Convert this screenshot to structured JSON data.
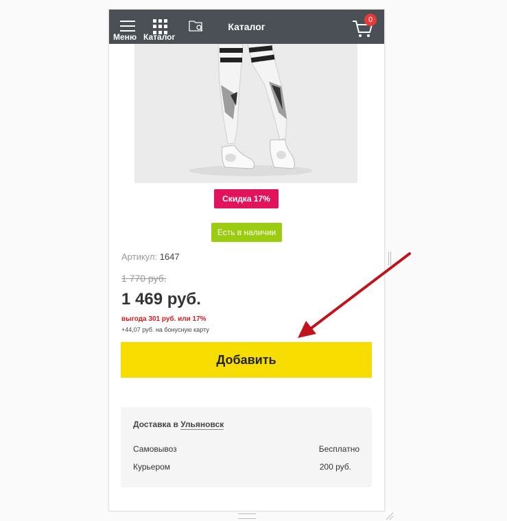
{
  "header": {
    "menu_label": "Меню",
    "catalog_label": "Каталог",
    "title": "Каталог",
    "cart_count": "0"
  },
  "product": {
    "discount_badge": "Скидка 17%",
    "stock_badge": "Есть в наличии",
    "article_label": "Артикул:",
    "article_value": "1647",
    "old_price": "1 770 руб.",
    "price": "1 469 руб.",
    "savings": "выгода 301 руб. или 17%",
    "bonus": "+44,07 руб. на бонусную карту",
    "add_button": "Добавить"
  },
  "delivery": {
    "heading": "Доставка в",
    "city": "Ульяновск",
    "options": [
      {
        "method": "Самовывоз",
        "price": "Бесплатно"
      },
      {
        "method": "Курьером",
        "price": "200 руб."
      }
    ]
  },
  "colors": {
    "topbar": "#4a4e55",
    "discount": "#e2135d",
    "stock": "#9ccc0f",
    "add_button": "#f7dc00",
    "arrow": "#c0141c"
  }
}
